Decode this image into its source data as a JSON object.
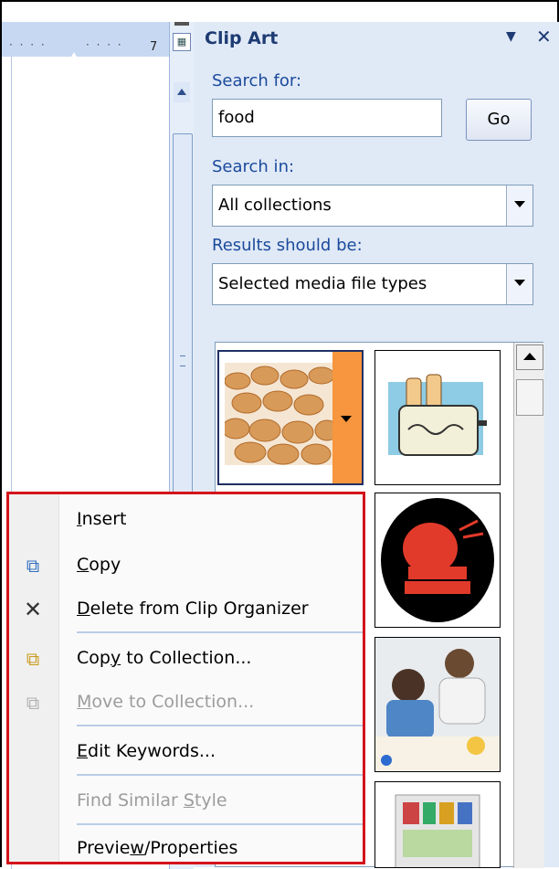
{
  "ruler": {
    "dots": "· · · ·",
    "dots2": "· · · ·",
    "number": "7"
  },
  "pane": {
    "title": "Clip Art",
    "search_label": "Search for:",
    "search_value": "food",
    "go_label": "Go",
    "search_in_label": "Search in:",
    "search_in_value": "All collections",
    "results_label": "Results should be:",
    "results_value": "Selected media file types"
  },
  "clips": [
    {
      "name": "cookies-clip"
    },
    {
      "name": "toaster-clip"
    },
    {
      "name": "red-food-clip"
    },
    {
      "name": "cooking-photo-clip"
    },
    {
      "name": "fridge-clip"
    }
  ],
  "menu": {
    "items": [
      {
        "label": "Insert",
        "u": "I",
        "rest": "nsert",
        "pre": ""
      },
      {
        "label": "Copy",
        "u": "C",
        "rest": "opy",
        "pre": ""
      },
      {
        "label": "Delete from Clip Organizer",
        "u": "D",
        "rest": "elete from Clip Organizer",
        "pre": ""
      },
      {
        "label": "Copy to Collection...",
        "pre": "Cop",
        "u": "y",
        "rest": " to Collection..."
      },
      {
        "label": "Move to Collection...",
        "pre": "",
        "u": "M",
        "rest": "ove to Collection..."
      },
      {
        "label": "Edit Keywords...",
        "pre": "",
        "u": "E",
        "rest": "dit Keywords..."
      },
      {
        "label": "Find Similar Style",
        "pre": "Find Similar ",
        "u": "S",
        "rest": "tyle"
      },
      {
        "label": "Preview/Properties",
        "pre": "Previe",
        "u": "w",
        "rest": "/Properties"
      }
    ]
  },
  "colors": {
    "accent": "#1d3b73",
    "menu_border": "#d4141b",
    "clip_arrow": "#f7963e"
  }
}
